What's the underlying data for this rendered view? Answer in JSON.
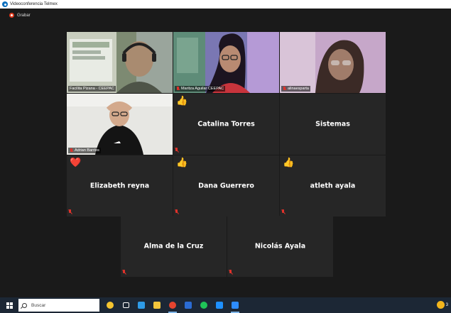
{
  "window": {
    "title": "Videoconferencia Telmex"
  },
  "recording": {
    "label": "Grabar"
  },
  "participants": {
    "facilita": {
      "name": "Facilita Pizana - CEEPAC"
    },
    "maritza": {
      "name": "Maritza Aguilar CEEPAC"
    },
    "alinaesparta": {
      "name": "alinaesparta"
    },
    "adrian": {
      "name": "Adrian Barrios"
    },
    "catalina": {
      "name": "Catalina Torres",
      "reaction": "👍"
    },
    "sistemas": {
      "name": "Sistemas"
    },
    "elizabeth": {
      "name": "Elizabeth reyna",
      "reaction": "❤️"
    },
    "dana": {
      "name": "Dana Guerrero",
      "reaction": "👍"
    },
    "atleth": {
      "name": "atleth ayala",
      "reaction": "👍"
    },
    "alma": {
      "name": "Alma de la Cruz"
    },
    "nicolas": {
      "name": "Nicolás Ayala"
    }
  },
  "taskbar": {
    "search_placeholder": "Buscar",
    "apps": [
      {
        "icon": "cortana-icon",
        "color": "#f4c430"
      },
      {
        "icon": "task-view-icon",
        "color": "#ffffff"
      },
      {
        "icon": "edge-icon",
        "color": "#2e9be8"
      },
      {
        "icon": "file-explorer-icon",
        "color": "#f3c53c"
      },
      {
        "icon": "chrome-icon",
        "color": "#e5442f"
      },
      {
        "icon": "word-icon",
        "color": "#2b6cd3"
      },
      {
        "icon": "spotify-icon",
        "color": "#1fc458"
      },
      {
        "icon": "videoconference-icon",
        "color": "#1e90ff"
      },
      {
        "icon": "zoom-icon",
        "color": "#2d8cff"
      }
    ],
    "tray_text": "3"
  },
  "colors": {
    "active_speaker": "#c9d34a",
    "tile_bg": "#262626",
    "stage_bg": "#1a1a1a",
    "muted": "#e0322b"
  }
}
